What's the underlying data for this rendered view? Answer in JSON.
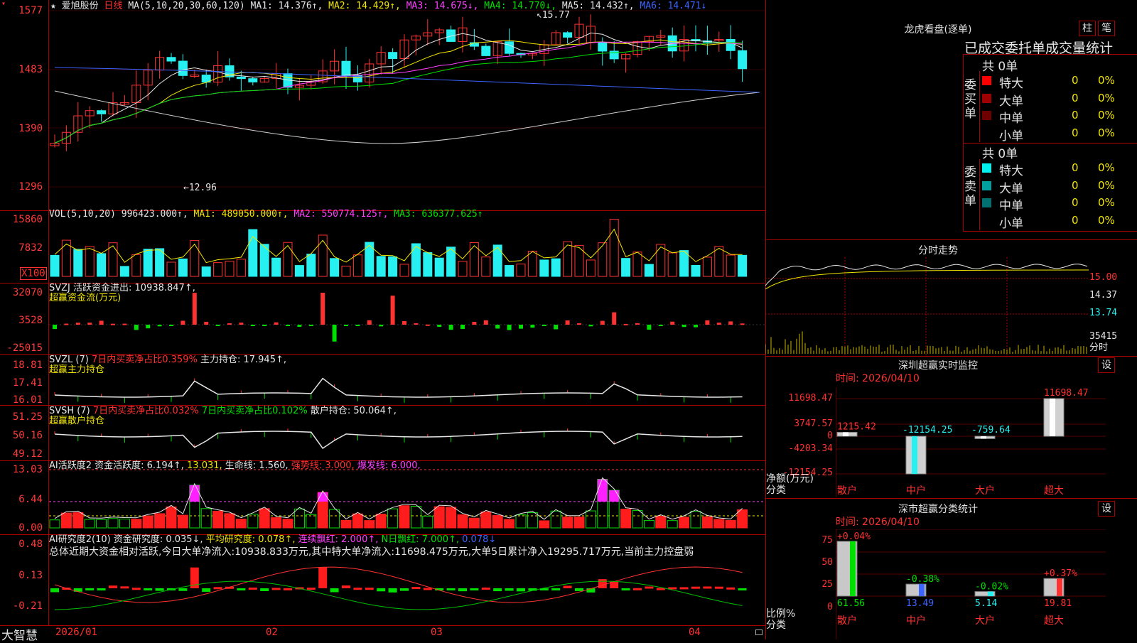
{
  "header": {
    "star": "★",
    "stock_name": "爱旭股份",
    "period": "日线",
    "ma_params": "MA(5,10,20,30,60,120)",
    "ma1": "MA1: 14.376↑,",
    "ma2": "MA2: 14.429↑,",
    "ma3": "MA3: 14.675↓,",
    "ma4": "MA4: 14.770↓,",
    "ma5": "MA5: 14.432↑,",
    "ma6": "MA6: 14.471↓"
  },
  "main_axis": [
    "1577",
    "1483",
    "1390",
    "1296"
  ],
  "main_annotations": {
    "high": "↖15.77",
    "low": "←12.96"
  },
  "vol": {
    "axis": [
      "15860",
      "7832",
      "X100"
    ],
    "title": "VOL(5,10,20)",
    "value": "996423.000↑,",
    "ma1": "MA1: 489050.000↑,",
    "ma2": "MA2: 550774.125↑,",
    "ma3": "MA3: 636377.625↑"
  },
  "svzj": {
    "axis": [
      "32070",
      "3528",
      "-25015"
    ],
    "title": "SVZJ  活跃资金进出: 10938.847↑,",
    "subtitle": "超赢资金流(万元)"
  },
  "svzl": {
    "axis": [
      "18.81",
      "17.41",
      "16.01"
    ],
    "title": "SVZL (7)",
    "ratio": "7日内买卖净占比0.359%",
    "hold": "主力持仓: 17.945↑,",
    "subtitle": "超赢主力持仓"
  },
  "svsh": {
    "axis": [
      "51.25",
      "50.16",
      "49.12"
    ],
    "title": "SVSH (7)",
    "ratio1": "7日内买卖净占比0.032%",
    "ratio2": "7日内买卖净占比0.102%",
    "hold": "散户持仓: 50.064↑,",
    "subtitle": "超赢散户持仓"
  },
  "ai_active": {
    "axis": [
      "13.03",
      "6.44",
      "0.00"
    ],
    "title": "AI活跃度2 资金活跃度: 6.194↑,",
    "l1": "13.031,",
    "l2": "生命线: 1.560,",
    "l3": "强势线: 3.000,",
    "l4": "爆发线: 6.000,"
  },
  "ai_research": {
    "axis": [
      "0.48",
      "0.13",
      "-0.21"
    ],
    "title": "AI研究度2(10) 资金研究度: 0.035↓,",
    "l1": "平均研究度: 0.078↑,",
    "l2": "连续飘红: 2.000↑,",
    "l3": "N日飘红: 7.000↑,",
    "l4": "0.078↓",
    "summary": "总体近期大资金相对活跃,今日大单净流入:10938.833万元,其中特大单净流入:11698.475万元,大单5日累计净入19295.717万元,当前主力控盘弱"
  },
  "date_axis": {
    "logo": "大智慧",
    "dates": [
      "2026/01",
      "02",
      "03",
      "04"
    ]
  },
  "dragon": {
    "title": "龙虎看盘(逐单)",
    "btn1": "柱",
    "btn2": "笔",
    "header": "已成交委托单成交量统计",
    "buy_label": "委买单",
    "sell_label": "委卖单",
    "buy_total": "共 0单",
    "sell_total": "共 0单",
    "buy_rows": [
      {
        "name": "特大",
        "count": "0",
        "pct": "0%",
        "color": "#ff0000"
      },
      {
        "name": "大单",
        "count": "0",
        "pct": "0%",
        "color": "#a00000"
      },
      {
        "name": "中单",
        "count": "0",
        "pct": "0%",
        "color": "#6e0000"
      },
      {
        "name": "小单",
        "count": "0",
        "pct": "0%",
        "color": ""
      }
    ],
    "sell_rows": [
      {
        "name": "特大",
        "count": "0",
        "pct": "0%",
        "color": "#00f0f0"
      },
      {
        "name": "大单",
        "count": "0",
        "pct": "0%",
        "color": "#00a0a0"
      },
      {
        "name": "中单",
        "count": "0",
        "pct": "0%",
        "color": "#007070"
      },
      {
        "name": "小单",
        "count": "0",
        "pct": "0%",
        "color": ""
      }
    ]
  },
  "minute": {
    "title": "分时走势",
    "axis": [
      "15.00",
      "14.37",
      "13.74",
      "35415",
      "分时"
    ]
  },
  "sz_monitor": {
    "title": "深圳超赢实时监控",
    "btn": "设",
    "time": "时间: 2026/04/10",
    "axis": [
      "11698.47",
      "3747.57",
      "0",
      "-4203.34",
      "-12154.25"
    ],
    "ylabel": "净额(万元)",
    "xlabel": "分类",
    "categories": [
      "散户",
      "中户",
      "大户",
      "超大"
    ],
    "chart_data": {
      "type": "bar",
      "categories": [
        "散户",
        "中户",
        "大户",
        "超大"
      ],
      "values": [
        1215.42,
        -12154.25,
        -759.64,
        11698.47
      ],
      "value_labels": [
        "1215.42",
        "-12154.25",
        "-759.64",
        "11698.47"
      ],
      "ylim": [
        -12154.25,
        11698.47
      ]
    }
  },
  "sz_class": {
    "title": "深市超赢分类统计",
    "btn": "设",
    "time": "时间: 2026/04/10",
    "axis": [
      "75",
      "50",
      "25",
      "0"
    ],
    "ylabel": "比例%",
    "xlabel": "分类",
    "categories": [
      "散户",
      "中户",
      "大户",
      "超大"
    ],
    "chart_data": {
      "type": "bar",
      "categories": [
        "散户",
        "中户",
        "大户",
        "超大"
      ],
      "values": [
        61.56,
        13.49,
        5.14,
        19.81
      ],
      "value_labels": [
        "61.56",
        "13.49",
        "5.14",
        "19.81"
      ],
      "changes": [
        "+0.04%",
        "-0.38%",
        "-0.02%",
        "+0.37%"
      ],
      "ylim": [
        0,
        75
      ]
    }
  }
}
